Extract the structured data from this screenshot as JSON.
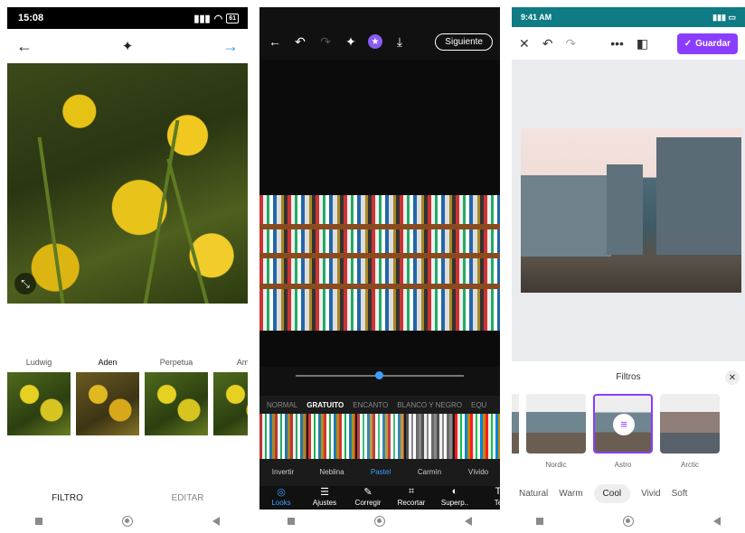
{
  "phone1": {
    "status_time": "15:08",
    "battery": "61",
    "filters": [
      {
        "label": "Ludwig",
        "selected": false
      },
      {
        "label": "Aden",
        "selected": true
      },
      {
        "label": "Perpetua",
        "selected": false
      },
      {
        "label": "Ama",
        "selected": false
      }
    ],
    "tabs": [
      {
        "label": "FILTRO",
        "active": true
      },
      {
        "label": "EDITAR",
        "active": false
      }
    ],
    "accent": "#3897f0"
  },
  "phone2": {
    "next_label": "Siguiente",
    "slider_value_fraction": 0.5,
    "categories": [
      {
        "label": "NORMAL",
        "selected": false
      },
      {
        "label": "GRATUITO",
        "selected": true
      },
      {
        "label": "ENCANTO",
        "selected": false
      },
      {
        "label": "BLANCO Y NEGRO",
        "selected": false
      },
      {
        "label": "EQU",
        "selected": false
      }
    ],
    "looks": [
      {
        "label": "Invertir",
        "selected": false
      },
      {
        "label": "Neblina",
        "selected": false
      },
      {
        "label": "Pastel",
        "selected": true
      },
      {
        "label": "Carmín",
        "selected": false
      },
      {
        "label": "Vívido",
        "selected": false
      }
    ],
    "tools": [
      {
        "label": "Looks",
        "icon": "looks-icon",
        "selected": true
      },
      {
        "label": "Ajustes",
        "icon": "sliders-icon",
        "selected": false
      },
      {
        "label": "Corregir",
        "icon": "brush-icon",
        "selected": false
      },
      {
        "label": "Recortar",
        "icon": "crop-icon",
        "selected": false
      },
      {
        "label": "Superp..",
        "icon": "overlay-icon",
        "selected": false
      },
      {
        "label": "Te",
        "icon": "text-icon",
        "selected": false
      }
    ],
    "accent": "#3aa0ff"
  },
  "phone3": {
    "status_time": "9:41 AM",
    "save_label": "Guardar",
    "panel_title": "Filtros",
    "filters": [
      {
        "label": "Nordic",
        "selected": false
      },
      {
        "label": "Astro",
        "selected": true
      },
      {
        "label": "Arctic",
        "selected": false
      }
    ],
    "categories": [
      {
        "label": "Natural",
        "selected": false
      },
      {
        "label": "Warm",
        "selected": false
      },
      {
        "label": "Cool",
        "selected": true
      },
      {
        "label": "Vivid",
        "selected": false
      },
      {
        "label": "Soft",
        "selected": false
      }
    ],
    "accent": "#8b3dff"
  }
}
